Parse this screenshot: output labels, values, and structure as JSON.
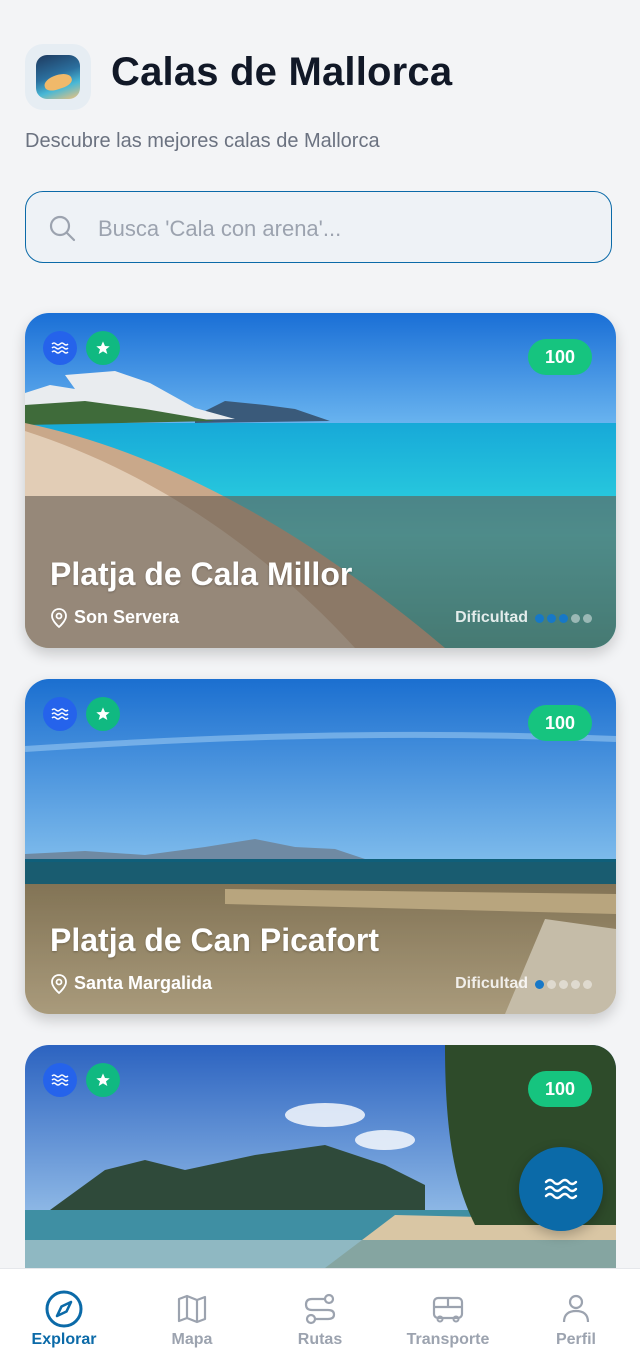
{
  "app": {
    "title": "Calas de Mallorca",
    "subtitle": "Descubre las mejores calas de Mallorca"
  },
  "search": {
    "value": "",
    "placeholder": "Busca 'Cala con arena'..."
  },
  "beaches": [
    {
      "name": "Platja de Cala Millor",
      "location": "Son Servera",
      "score": "100",
      "difficulty_label": "Dificultad",
      "difficulty": 3,
      "difficulty_max": 5
    },
    {
      "name": "Platja de Can Picafort",
      "location": "Santa Margalida",
      "score": "100",
      "difficulty_label": "Dificultad",
      "difficulty": 1,
      "difficulty_max": 5
    },
    {
      "name": "",
      "location": "",
      "score": "100"
    }
  ],
  "tabs": [
    {
      "label": "Explorar",
      "icon": "compass-icon",
      "active": true
    },
    {
      "label": "Mapa",
      "icon": "map-icon",
      "active": false
    },
    {
      "label": "Rutas",
      "icon": "route-icon",
      "active": false
    },
    {
      "label": "Transporte",
      "icon": "bus-icon",
      "active": false
    },
    {
      "label": "Perfil",
      "icon": "user-icon",
      "active": false
    }
  ],
  "colors": {
    "accent": "#0b6aa8",
    "score_badge": "#16c47f",
    "water_badge": "#2563eb",
    "star_badge": "#10b981",
    "inactive_tab": "#9ca3af"
  }
}
